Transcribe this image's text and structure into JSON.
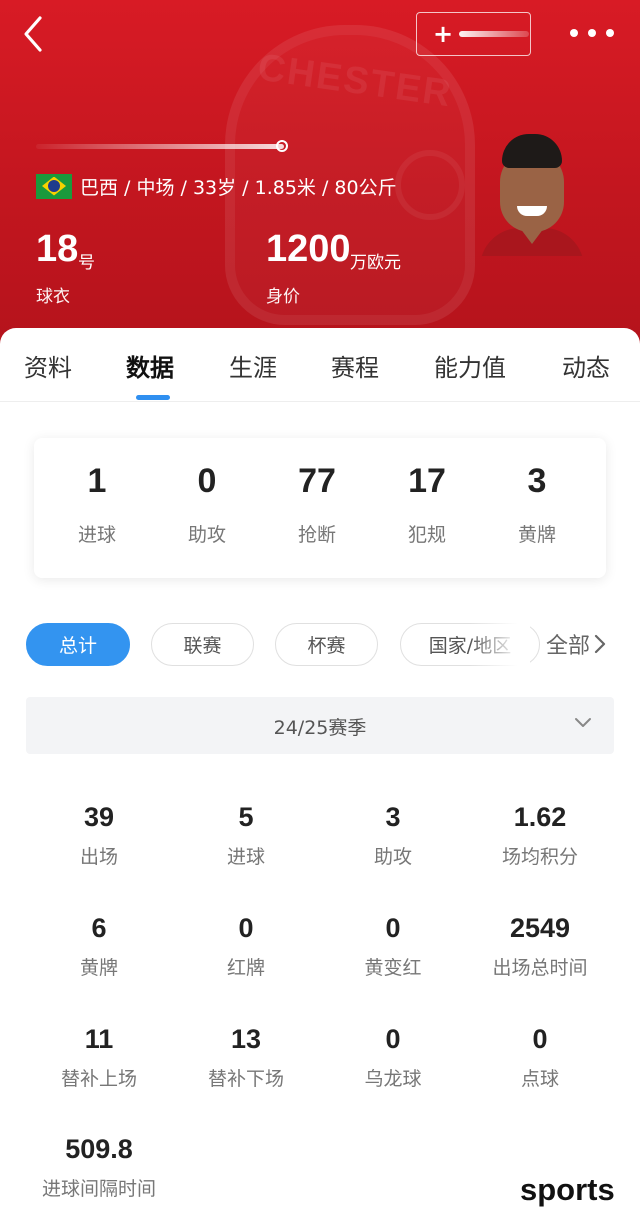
{
  "header": {
    "follow_button": {
      "label": "+",
      "icon": "plus-icon"
    },
    "more_button": {
      "icon": "more-dots-icon"
    },
    "back_button": {
      "icon": "back-chevron-icon"
    },
    "country_flag": "brazil-flag-icon",
    "info": "巴西 / 中场 / 33岁 / 1.85米 / 80公斤",
    "jersey_number": {
      "value": "18",
      "unit": "号",
      "label": "球衣"
    },
    "market_value": {
      "value": "1200",
      "unit": "万欧元",
      "label": "身价"
    },
    "colors": {
      "header_bg": "#c8161f",
      "accent": "#3394f0"
    }
  },
  "tabs": [
    {
      "label": "资料",
      "active": false
    },
    {
      "label": "数据",
      "active": true
    },
    {
      "label": "生涯",
      "active": false
    },
    {
      "label": "赛程",
      "active": false
    },
    {
      "label": "能力值",
      "active": false
    },
    {
      "label": "动态",
      "active": false
    }
  ],
  "summary": [
    {
      "value": "1",
      "label": "进球"
    },
    {
      "value": "0",
      "label": "助攻"
    },
    {
      "value": "77",
      "label": "抢断"
    },
    {
      "value": "17",
      "label": "犯规"
    },
    {
      "value": "3",
      "label": "黄牌"
    }
  ],
  "filters": {
    "pills": [
      {
        "label": "总计",
        "active": true
      },
      {
        "label": "联赛",
        "active": false
      },
      {
        "label": "杯赛",
        "active": false
      },
      {
        "label": "国家/地区",
        "active": false
      }
    ],
    "all_label": "全部",
    "all_icon": "chevron-right-icon"
  },
  "season": {
    "label": "24/25赛季",
    "icon": "chevron-down-icon"
  },
  "stats": [
    {
      "value": "39",
      "label": "出场"
    },
    {
      "value": "5",
      "label": "进球"
    },
    {
      "value": "3",
      "label": "助攻"
    },
    {
      "value": "1.62",
      "label": "场均积分"
    },
    {
      "value": "6",
      "label": "黄牌"
    },
    {
      "value": "0",
      "label": "红牌"
    },
    {
      "value": "0",
      "label": "黄变红"
    },
    {
      "value": "2549",
      "label": "出场总时间"
    },
    {
      "value": "11",
      "label": "替补上场"
    },
    {
      "value": "13",
      "label": "替补下场"
    },
    {
      "value": "0",
      "label": "乌龙球"
    },
    {
      "value": "0",
      "label": "点球"
    },
    {
      "value": "509.8",
      "label": "进球间隔时间"
    }
  ],
  "watermark": "sports"
}
